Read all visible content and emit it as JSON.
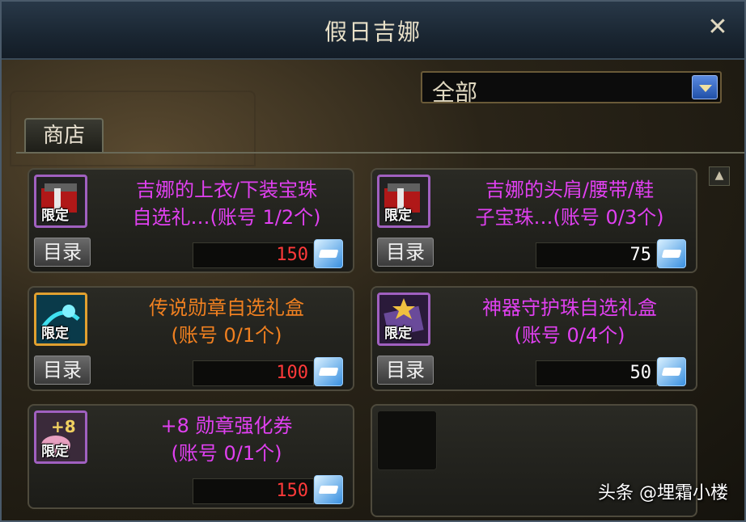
{
  "window": {
    "title": "假日吉娜",
    "close_glyph": "✕"
  },
  "filter": {
    "selected": "全部"
  },
  "tabs": [
    {
      "label": "商店"
    }
  ],
  "items": [
    {
      "name": "吉娜的上衣/下装宝珠自选礼…(账号 1/2个)",
      "name_line1": "吉娜的上衣/下装宝珠",
      "name_line2": "自选礼…(账号 1/2个)",
      "name_color": "#e040f0",
      "badge": "限定",
      "catalog": "目录",
      "price": "150",
      "price_color": "#ff3a3a",
      "icon": "red-gift-box-icon"
    },
    {
      "name": "吉娜的头肩/腰带/鞋子宝珠…(账号 0/3个)",
      "name_line1": "吉娜的头肩/腰带/鞋",
      "name_line2": "子宝珠…(账号 0/3个)",
      "name_color": "#e040f0",
      "badge": "限定",
      "catalog": "目录",
      "price": "75",
      "price_color": "#ffffff",
      "icon": "red-gift-box-icon"
    },
    {
      "name": "传说勋章自选礼盒(账号 0/1个)",
      "name_line1": "传说勋章自选礼盒",
      "name_line2": "(账号 0/1个)",
      "name_color": "#f08020",
      "badge": "限定",
      "catalog": "目录",
      "price": "100",
      "price_color": "#ff3a3a",
      "icon": "legendary-medal-box-icon"
    },
    {
      "name": "神器守护珠自选礼盒(账号 0/4个)",
      "name_line1": "神器守护珠自选礼盒",
      "name_line2": "(账号 0/4个)",
      "name_color": "#e040f0",
      "badge": "限定",
      "catalog": "目录",
      "price": "50",
      "price_color": "#ffffff",
      "icon": "artifact-orb-box-icon"
    },
    {
      "name": "+8 勋章强化券(账号 0/1个)",
      "name_line1": "+8 勋章强化券",
      "name_line2": "(账号 0/1个)",
      "name_color": "#e040f0",
      "badge": "限定",
      "catalog": "目录",
      "price": "150",
      "price_color": "#ff3a3a",
      "icon": "plus8-ticket-icon"
    }
  ],
  "watermark": "头条 @埋霜小楼"
}
